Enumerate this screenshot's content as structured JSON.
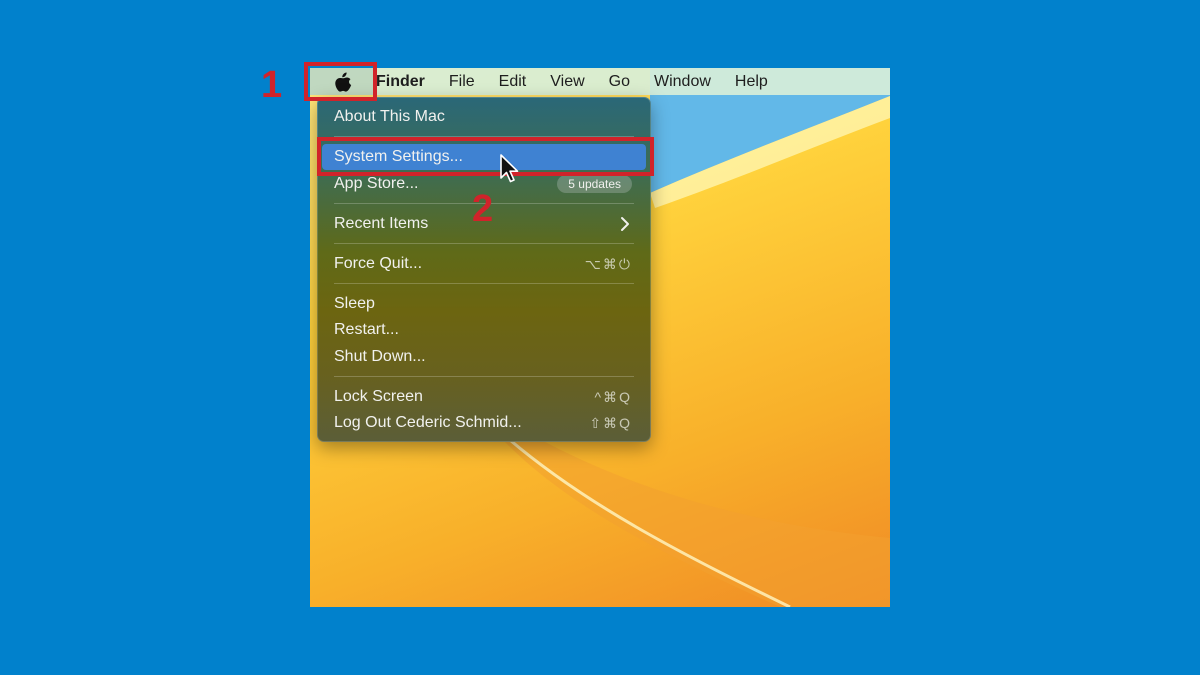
{
  "colors": {
    "background": "#0181cc",
    "callout": "#d1232a",
    "menu_selection": "#3f82d2"
  },
  "menubar": {
    "apple_icon": "apple-logo-icon",
    "app_name": "Finder",
    "items": [
      "File",
      "Edit",
      "View",
      "Go",
      "Window",
      "Help"
    ]
  },
  "apple_menu": {
    "about": "About This Mac",
    "system_settings": "System Settings...",
    "app_store": "App Store...",
    "app_store_badge": "5 updates",
    "recent_items": "Recent Items",
    "force_quit": "Force Quit...",
    "force_quit_shortcut": "⌥⌘⏻",
    "sleep": "Sleep",
    "restart": "Restart...",
    "shut_down": "Shut Down...",
    "lock_screen": "Lock Screen",
    "lock_screen_shortcut": "^⌘Q",
    "log_out": "Log Out Cederic Schmid...",
    "log_out_shortcut": "⇧⌘Q"
  },
  "callouts": {
    "step1": "1",
    "step2": "2"
  }
}
